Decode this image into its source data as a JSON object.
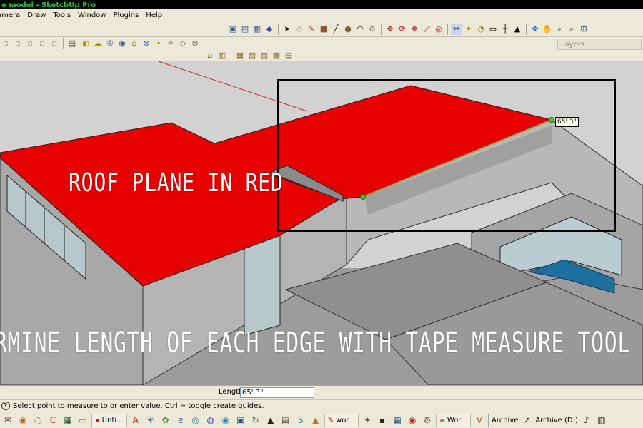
{
  "window": {
    "title": "e model - SketchUp Pro"
  },
  "menu": [
    "amera",
    "Draw",
    "Tools",
    "Window",
    "Plugins",
    "Help"
  ],
  "toolbar": {
    "row1_icons": [
      "box-icon",
      "views-icon",
      "section-icon",
      "component-icon",
      "select-icon",
      "eraser-icon",
      "paint-icon",
      "rectangle-icon",
      "line-icon",
      "circle-icon",
      "arc-icon",
      "push-pull-icon",
      "move-icon",
      "rotate-icon",
      "follow-me-icon",
      "scale-icon",
      "offset-icon",
      "tape-measure-icon",
      "dimension-icon",
      "protractor-icon",
      "text-icon",
      "axes-icon",
      "3d-text-icon",
      "orbit-icon",
      "pan-icon",
      "zoom-icon",
      "zoom-window-icon",
      "zoom-extents-icon"
    ],
    "row2_icons": [
      "shadow-icon",
      "fog-icon",
      "style-icon",
      "geo-icon",
      "warehouse-icon",
      "share-icon",
      "component-upload-icon",
      "solid-icon",
      "extension-icon"
    ],
    "row3_icons": [
      "house-icon",
      "front-icon",
      "right-icon",
      "back-icon",
      "left-icon",
      "bottom-icon"
    ]
  },
  "layers_panel": {
    "label": "Layers"
  },
  "overlay": {
    "roof_label": "ROOF PLANE IN RED",
    "tape_label": "RMINE LENGTH OF EACH EDGE WITH TAPE MEASURE TOOL"
  },
  "measure": {
    "tooltip": "65' 3\""
  },
  "status": {
    "length_label": "Length",
    "length_value": "65' 3\"",
    "hint": "Select point to measure to or enter value.  Ctrl = toggle create guides."
  },
  "taskbar": {
    "task_untitled": "Unti...",
    "task_word1": "wor...",
    "task_word2": "Wor...",
    "tray_archive": "Archive",
    "tray_drive": "Archive (D:)"
  },
  "colors": {
    "roof": "#e60000",
    "highlight_edge": "#9aa64a",
    "title_text": "#2fbf3a"
  }
}
